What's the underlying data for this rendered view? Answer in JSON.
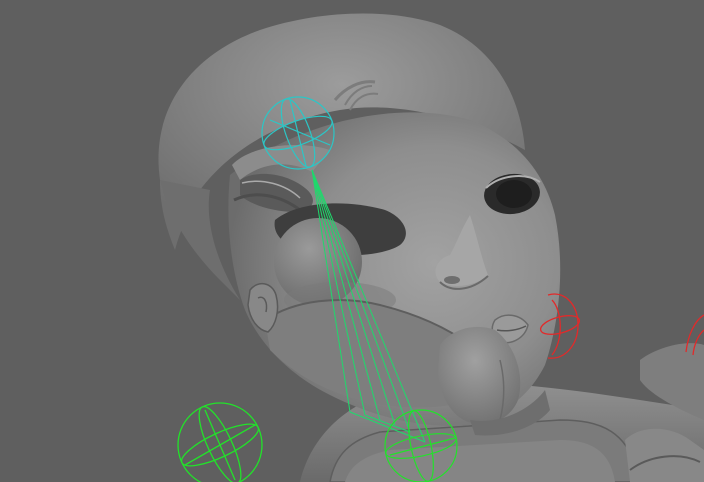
{
  "viewport": {
    "background_color": "#5f5f5f",
    "mesh_color": "#8a8a8a",
    "colors": {
      "rig_green": "#22e22a",
      "rig_cyan": "#2cc6c6",
      "rig_red": "#e22a2a",
      "joint_line": "#1fd96c"
    },
    "objects": [
      {
        "id": "head-mesh",
        "kind": "shaded polygon mesh"
      },
      {
        "id": "eye-joint-control",
        "kind": "sphere manipulator",
        "color": "cyan"
      },
      {
        "id": "jaw-joint-control",
        "kind": "sphere manipulator",
        "color": "green"
      },
      {
        "id": "cheek-joint-control",
        "kind": "sphere manipulator",
        "color": "red"
      },
      {
        "id": "body-joint-control",
        "kind": "sphere manipulator",
        "color": "green"
      },
      {
        "id": "shoulder-joint-control",
        "kind": "sphere manipulator",
        "color": "red"
      }
    ]
  }
}
